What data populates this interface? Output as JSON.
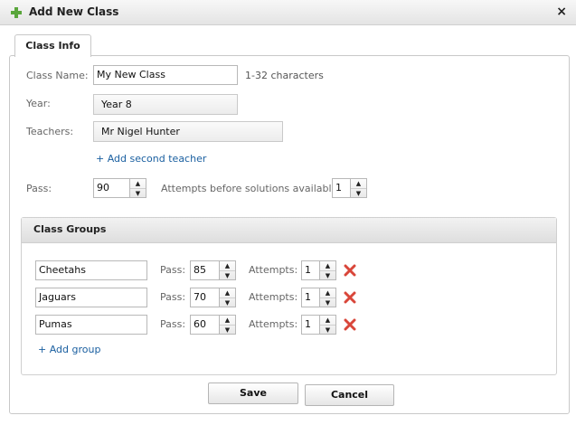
{
  "window": {
    "title": "Add New Class",
    "close_label": "×"
  },
  "tab": {
    "label": "Class Info"
  },
  "form": {
    "class_name_label": "Class Name:",
    "class_name_value": "My New Class",
    "class_name_hint": "1-32 characters",
    "year_label": "Year:",
    "year_value": "Year 8",
    "teachers_label": "Teachers:",
    "teacher_value": "Mr Nigel Hunter",
    "add_teacher_link": "+ Add second teacher",
    "pass_label": "Pass:",
    "pass_value": "90",
    "attempts_label": "Attempts before solutions available:",
    "attempts_value": "1"
  },
  "groups": {
    "title": "Class Groups",
    "pass_label": "Pass:",
    "attempts_label": "Attempts:",
    "rows": [
      {
        "name": "Cheetahs",
        "pass": "85",
        "attempts": "1"
      },
      {
        "name": "Jaguars",
        "pass": "70",
        "attempts": "1"
      },
      {
        "name": "Pumas",
        "pass": "60",
        "attempts": "1"
      }
    ],
    "add_link": "+ Add group"
  },
  "actions": {
    "save_label": "Save",
    "cancel_label": "Cancel"
  },
  "colors": {
    "accent_plus": "#5aa63c",
    "delete_red": "#d9463a",
    "link": "#1a5fa0"
  },
  "icons": {
    "title_icon": "plus-icon",
    "delete_icon": "delete-icon",
    "spinner_up": "arrow-up-icon",
    "spinner_down": "arrow-down-icon"
  }
}
